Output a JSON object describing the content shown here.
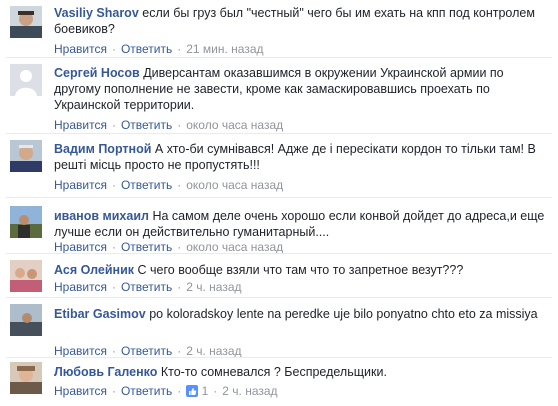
{
  "actions": {
    "like": "Нравится",
    "reply": "Ответить",
    "sep": "·"
  },
  "comments": [
    {
      "author": "Vasiliy Sharov",
      "text": "если бы груз был \"честный\" чего бы им ехать на кпп под контролем боевиков?",
      "time": "21 мин. назад"
    },
    {
      "author": "Сергей Носов",
      "text": "Диверсантам оказавшимся в окружении Украинской армии по другому пополнение не завести, кроме как замаскировавшись проехать по Украинской территории.",
      "time": "около часа назад"
    },
    {
      "author": "Вадим Портной",
      "text": "А хто-би сумнівався! Адже де і пересікати кордон то тільки там! В решті місць просто не пропустять!!!",
      "time": "около часа назад"
    },
    {
      "author": "иванов михаил",
      "text": "На самом деле очень хорошо если конвой дойдет до адреса,и еще лучше если он действительно гуманитарный....",
      "time": "около часа назад"
    },
    {
      "author": "Ася Олейник",
      "text": "С чего вообще взяли что там что то запретное везут???",
      "time": "2 ч. назад"
    },
    {
      "author": "Etibar Gasimov",
      "text": "po koloradskoy lente na peredke uje bilo ponyatno chto eto za missiya",
      "time": "2 ч. назад"
    },
    {
      "author": "Любовь Галенко",
      "text": "Кто-то сомневался ? Беспредельщики.",
      "time": "2 ч. назад",
      "likes": "1"
    }
  ]
}
